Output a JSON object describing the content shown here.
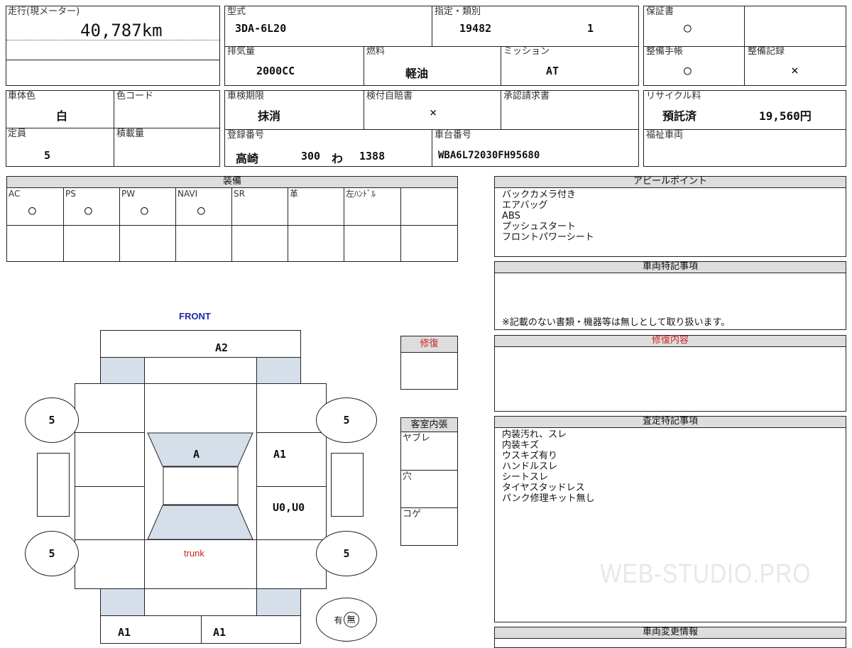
{
  "mileage": {
    "label": "走行(現メーター)",
    "value": "40,787km"
  },
  "model": {
    "label": "型式",
    "value": "3DA-6L20"
  },
  "designation": {
    "label": "指定・類別",
    "value1": "19482",
    "value2": "1"
  },
  "warranty": {
    "label": "保証書",
    "value": "○"
  },
  "displacement": {
    "label": "排気量",
    "value": "2000CC"
  },
  "fuel": {
    "label": "燃料",
    "value": "軽油"
  },
  "transmission": {
    "label": "ミッション",
    "value": "AT"
  },
  "maintenance_book": {
    "label": "整備手帳",
    "value": "○"
  },
  "maintenance_record": {
    "label": "整備記録",
    "value": "×"
  },
  "body_color": {
    "label": "車体色",
    "value": "白"
  },
  "color_code": {
    "label": "色コード",
    "value": ""
  },
  "inspection": {
    "label": "車検期限",
    "value": "抹消"
  },
  "insurance": {
    "label": "検付自賠書",
    "value": "×"
  },
  "approval": {
    "label": "承認請求書",
    "value": ""
  },
  "recycle": {
    "label": "リサイクル料",
    "status": "預託済",
    "amount": "19,560円"
  },
  "capacity": {
    "label": "定員",
    "value": "5"
  },
  "load": {
    "label": "積載量",
    "value": ""
  },
  "registration": {
    "label": "登録番号",
    "place": "高崎",
    "class": "300",
    "kana": "わ",
    "number": "1388"
  },
  "chassis": {
    "label": "車台番号",
    "value": "WBA6L72030FH95680"
  },
  "welfare": {
    "label": "福祉車両",
    "value": ""
  },
  "equipment": {
    "title": "装備",
    "items": [
      {
        "label": "AC",
        "mark": "○"
      },
      {
        "label": "PS",
        "mark": "○"
      },
      {
        "label": "PW",
        "mark": "○"
      },
      {
        "label": "NAVI",
        "mark": "○"
      },
      {
        "label": "SR",
        "mark": ""
      },
      {
        "label": "革",
        "mark": ""
      },
      {
        "label": "左ﾊﾝﾄﾞﾙ",
        "mark": ""
      }
    ]
  },
  "appeal": {
    "title": "アピールポイント",
    "lines": "バックカメラ付き\nエアバッグ\nABS\nプッシュスタート\nフロントパワーシート"
  },
  "vehicle_notes": {
    "title": "車両特記事項",
    "text": "※記載のない書類・機器等は無しとして取り扱います。"
  },
  "repair_details": {
    "title": "修復内容",
    "text": ""
  },
  "assessment_notes": {
    "title": "査定特記事項",
    "lines": "内装汚れ、スレ\n内装キズ\nウスキズ有り\nハンドルスレ\nシートスレ\nタイヤスタッドレス\nパンク修理キット無し"
  },
  "vehicle_change": {
    "title": "車両変更情報"
  },
  "repair": {
    "title": "修復"
  },
  "interior": {
    "title": "客室内張",
    "rows": [
      "ヤブレ",
      "穴",
      "コゲ"
    ]
  },
  "diagram": {
    "front": "FRONT",
    "trunk": "trunk",
    "tires": [
      "5",
      "5",
      "5",
      "5"
    ],
    "marks": {
      "front_bumper": "A2",
      "windshield": "A",
      "right_front": "A1",
      "right_rear": "U0,U0",
      "rear_left": "A1",
      "rear_right": "A1"
    },
    "option_yes": "有",
    "option_no": "無"
  },
  "watermark": "WEB-STUDIO.PRO",
  "colors": {
    "header_bg": "#dddddd",
    "panel_blue": "#d5dfea",
    "accent_red": "#cc2222",
    "front_blue": "#1a2aa8"
  }
}
